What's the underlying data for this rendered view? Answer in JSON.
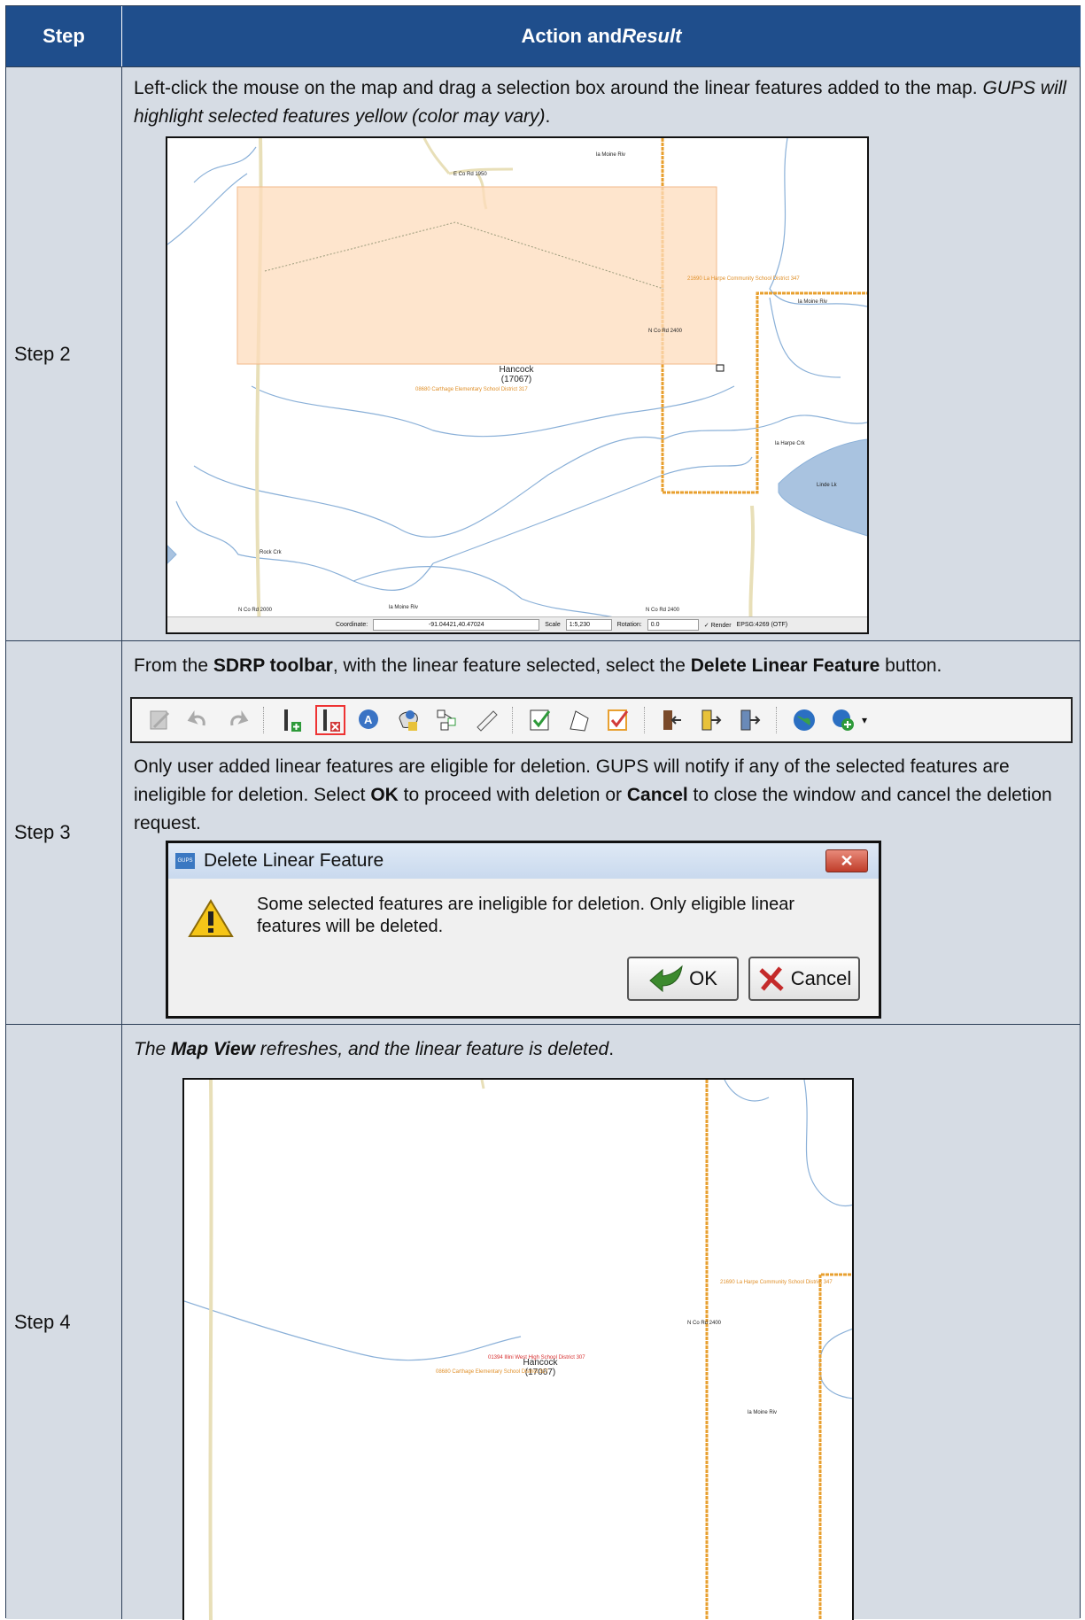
{
  "header": {
    "col1": "Step",
    "col2_prefix": "Action and ",
    "col2_italic": "Result"
  },
  "rows": [
    {
      "step": "Step 2",
      "text_plain": "Left-click the mouse on the map and drag a selection box around the linear features added to the map. ",
      "text_italic": "GUPS will highlight selected features yellow (color may vary)",
      "text_end": ".",
      "map": {
        "labels": {
          "la_moine_top": "la Moine Riv",
          "e_co_rd": "E Co Rd 1950",
          "school_347": "21690 La Harpe Community School District 347",
          "la_moine_right": "la Moine Riv",
          "n_co_rd_2400": "N Co Rd 2400",
          "hancock": "Hancock",
          "fips": "(17067)",
          "carthage": "08680 Carthage Elementary School District 317",
          "la_harpe_crk": "la Harpe Crk",
          "linde_lk": "Linde Lk",
          "rock_crk": "Rock Crk",
          "n_co_rd_2000": "N Co Rd 2000",
          "la_moine_bottom": "la Moine Riv",
          "n_co_rd_2400b": "N Co Rd 2400"
        },
        "status": {
          "coord_label": "Coordinate:",
          "coord_value": "-91.04421,40.47024",
          "scale_label": "Scale",
          "scale_value": "1:5,230",
          "rotation_label": "Rotation:",
          "rotation_value": "0.0",
          "render_label": "Render",
          "crs": "EPSG:4269 (OTF)"
        }
      }
    },
    {
      "step": "Step 3",
      "p1": {
        "a": "From the ",
        "b1": "SDRP toolbar",
        "c": ", with the linear feature selected, select the ",
        "b2": "Delete Linear Feature",
        "d": " button."
      },
      "p2": {
        "a": "Only user added linear features are eligible for deletion. GUPS will notify if any of the selected features are ineligible for deletion. Select ",
        "b1": "OK",
        "c": " to proceed with deletion or ",
        "b2": "Cancel",
        "d": " to close the window and cancel the deletion request."
      },
      "dialog": {
        "app_icon": "GUPS",
        "title": "Delete Linear Feature",
        "message": "Some selected features are ineligible for deletion. Only eligible linear features will be deleted.",
        "ok": "OK",
        "cancel": "Cancel"
      }
    },
    {
      "step": "Step 4",
      "italic_a": "The ",
      "bold_italic": "Map View",
      "italic_b": " refreshes, and the linear feature is deleted",
      "end": ".",
      "map": {
        "labels": {
          "school_347": "21690 La Harpe Community School District 347",
          "n_co_rd_2400": "N Co Rd 2400",
          "hancock": "Hancock",
          "fips": "(17067)",
          "red_school": "01394 Illini West High School District 307",
          "carthage": "08680 Carthage Elementary School District 317",
          "la_moine": "la Moine Riv"
        }
      }
    }
  ],
  "colors": {
    "header": "#1f4e8c",
    "cell": "#d6dce4",
    "selection": "#fddcbc",
    "boundary": "#e8a030",
    "water": "#a9c3e0"
  }
}
